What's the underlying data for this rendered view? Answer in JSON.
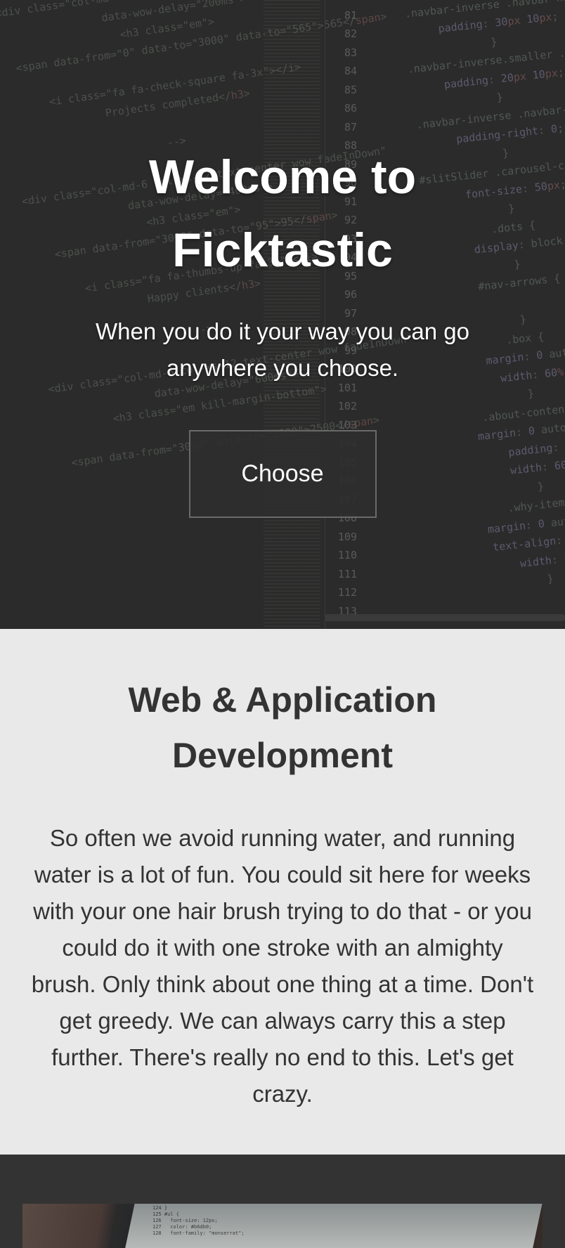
{
  "hero": {
    "title_line1": "Welcome to",
    "title_line2": "Ficktastic",
    "subtitle": "When you do it your way you can go anywhere you choose.",
    "button_label": "Choose"
  },
  "services": {
    "title": "Web & Application Development",
    "text": "So often we avoid running water, and running water is a lot of fun. You could sit here for weeks with your one hair brush trying to do that - or you could do it with one stroke with an almighty brush. Only think about one thing at a time. Don't get greedy. We can always carry this a step further. There's really no end to this. Let's get crazy."
  },
  "colors": {
    "hero_bg": "#2b2b2b",
    "services_bg": "#e9e9e9",
    "gallery_bg": "#333333",
    "text_dark": "#333333",
    "text_light": "#ffffff"
  },
  "gallery": {
    "image": "laptop-code-photo"
  }
}
